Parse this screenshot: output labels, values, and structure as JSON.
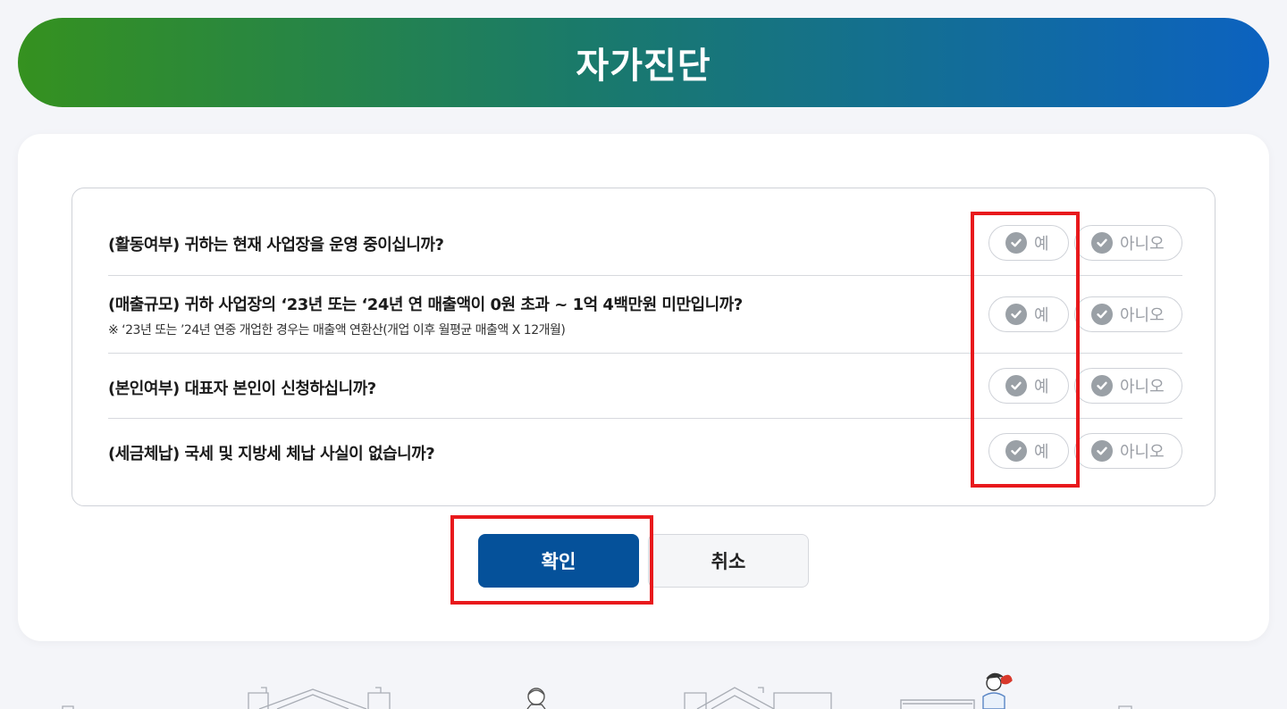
{
  "header": {
    "title": "자가진단"
  },
  "questions": [
    {
      "text": "(활동여부) 귀하는 현재 사업장을 운영 중이십니까?",
      "note": "",
      "yes_label": "예",
      "no_label": "아니오"
    },
    {
      "text": "(매출규모) 귀하 사업장의 ‘23년 또는 ‘24년 연 매출액이 0원 초과 ~ 1억 4백만원 미만입니까?",
      "note": "※ ‘23년 또는 ’24년 연중 개업한 경우는 매출액 연환산(개업 이후 월평균 매출액 X 12개월)",
      "yes_label": "예",
      "no_label": "아니오"
    },
    {
      "text": "(본인여부) 대표자 본인이 신청하십니까?",
      "note": "",
      "yes_label": "예",
      "no_label": "아니오"
    },
    {
      "text": "(세금체납) 국세 및 지방세 체납 사실이 없습니까?",
      "note": "",
      "yes_label": "예",
      "no_label": "아니오"
    }
  ],
  "actions": {
    "confirm_label": "확인",
    "cancel_label": "취소"
  },
  "colors": {
    "banner_gradient_start": "#35911f",
    "banner_gradient_end": "#0c62c0",
    "confirm_button": "#05519a",
    "highlight_box": "#e8191c",
    "check_icon": "#9aa0a6"
  }
}
